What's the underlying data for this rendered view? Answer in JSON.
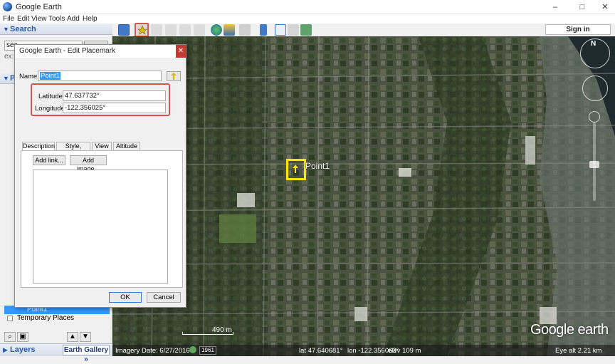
{
  "window": {
    "title": "Google Earth",
    "controls": [
      "–",
      "□",
      "✕"
    ]
  },
  "menu": [
    "File",
    "Edit",
    "View",
    "Tools",
    "Add",
    "Help"
  ],
  "toolbar": {
    "sign_in_label": "Sign in",
    "icons": [
      "sidebar-toggle-icon",
      "add-placemark-icon",
      "add-polygon-icon",
      "add-path-icon",
      "add-image-overlay-icon",
      "record-tour-icon",
      "historical-imagery-icon",
      "sunlight-icon",
      "planets-icon",
      "ruler-icon",
      "email-icon",
      "print-icon",
      "save-image-icon"
    ]
  },
  "sidebar": {
    "search_header": "Search",
    "search_value": "sea",
    "search_hint": "ex: P",
    "places_rows": [
      {
        "label": "Point1",
        "selected": true
      },
      {
        "label": "Temporary Places",
        "selected": false
      }
    ],
    "layers_label": "Layers",
    "earth_gallery_label": "Earth Gallery »"
  },
  "dialog": {
    "title": "Google Earth - Edit Placemark",
    "name_label": "Name:",
    "name_value": "Point1",
    "latitude_label": "Latitude:",
    "latitude_value": "47.637732°",
    "longitude_label": "Longitude:",
    "longitude_value": "-122.356025°",
    "tabs": [
      "Description",
      "Style, Color",
      "View",
      "Altitude"
    ],
    "active_tab": "Description",
    "add_link_label": "Add link...",
    "add_image_label": "Add image...",
    "ok_label": "OK",
    "cancel_label": "Cancel"
  },
  "map": {
    "point_label": "Point1",
    "scale_label": "490 m",
    "watermark": "Google earth",
    "status": {
      "imagery_date": "Imagery Date: 6/27/2016",
      "year": "1961",
      "lat": "lat   47.640681°",
      "lon": "lon -122.356063°",
      "elev": "elev   109 m",
      "eye_alt": "Eye alt     2.21 km"
    }
  },
  "colors": {
    "highlight": "#d9534f",
    "placemark": "#ffe400",
    "selection": "#3399ff"
  }
}
